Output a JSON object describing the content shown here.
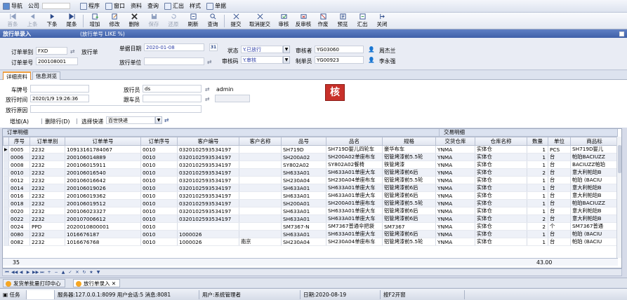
{
  "menubar": {
    "items": [
      "导航",
      "公司",
      "程序",
      "窗口",
      "资料",
      "查询",
      "汇出",
      "样式",
      "单据"
    ]
  },
  "toolbar": {
    "buttons": [
      "首条",
      "上条",
      "下条",
      "尾条",
      "增加",
      "修改",
      "删除",
      "保存",
      "还原",
      "刷新",
      "查询",
      "提交",
      "取消提交",
      "审核",
      "反审核",
      "作废",
      "预览",
      "汇出",
      "关闭"
    ]
  },
  "title": {
    "name": "放行单录入",
    "subtitle": "(放行单号 LIKE %)"
  },
  "header": {
    "order_type_label": "订单单别",
    "order_type_value": "FXD",
    "order_type_name": "放行单",
    "order_no_label": "订单单号",
    "order_no_value": "200108001",
    "date_label": "单据日期",
    "date_value": "2020-01-08",
    "date_btn": "31",
    "unit_label": "放行单位",
    "status_label": "状态",
    "status_value": "Y.已放行",
    "audit_code_label": "审核码",
    "audit_code_value": "Y.审核",
    "auditor_label": "审核者",
    "auditor_code": "YG03060",
    "auditor_name": "周杰兰",
    "maker_label": "制单员",
    "maker_code": "YG00923",
    "maker_name": "李永强"
  },
  "tabs": [
    "详细资料",
    "信息浏览"
  ],
  "detail": {
    "plate_label": "车牌号",
    "releaser_label": "放行员",
    "releaser_value": "ds",
    "releaser_name": "admin",
    "time_label": "放行时间",
    "time_value": "2020/1/9 19:26:36",
    "follower_label": "跟车员",
    "reason_label": "放行原因",
    "add_row": "增加(A)",
    "del_row": "删除行(D)",
    "express_label": "选择快递",
    "express_value": "百世快递",
    "audit_badge": "核"
  },
  "grid": {
    "group1": "订单明细",
    "group2": "交易明细",
    "columns": [
      "序号",
      "订单单别",
      "订单单号",
      "订单序号",
      "客户编号",
      "客户名称",
      "品号",
      "品名",
      "规格",
      "交货仓库",
      "仓库名称",
      "数量",
      "单位",
      "商品标"
    ],
    "rows": [
      [
        "0005",
        "2232",
        "10913161784067",
        "0010",
        "0320102593534197",
        "",
        "SH719D",
        "SH719D婴儿四轮车",
        "豪华布车",
        "YNMA",
        "实体仓",
        "1",
        "PCS",
        "SH719D婴儿"
      ],
      [
        "0006",
        "2232",
        "200106014889",
        "0010",
        "0320102593534197",
        "",
        "SH200A02",
        "SH200A02单座布车",
        "铝管烤漆前5.5轮",
        "YNMA",
        "实体仓",
        "1",
        "台",
        "帕珀BACIUZZ"
      ],
      [
        "0008",
        "2232",
        "200106015911",
        "0010",
        "0320102593534197",
        "",
        "SY802A02",
        "SY802A02餐椅",
        "铁管烤漆",
        "YNMA",
        "实体仓",
        "1",
        "台",
        "BACIUZZ帕珀"
      ],
      [
        "0010",
        "2232",
        "200106016540",
        "0010",
        "0320102593534197",
        "",
        "SH633A01",
        "SH633A01单座大车",
        "铝管烤漆前6后",
        "YNMA",
        "实体仓",
        "2",
        "台",
        "意大利帕珀B"
      ],
      [
        "0012",
        "2232",
        "200106016642",
        "0010",
        "0320102593534197",
        "",
        "SH230A04",
        "SH230A04单座布车",
        "铝管烤漆前5.5轮",
        "YNMA",
        "实体仓",
        "1",
        "台",
        "帕珀 (BACIU"
      ],
      [
        "0014",
        "2232",
        "200106019026",
        "0010",
        "0320102593534197",
        "",
        "SH633A01",
        "SH633A01单座大车",
        "铝管烤漆前6后",
        "YNMA",
        "实体仓",
        "1",
        "台",
        "意大利帕珀B"
      ],
      [
        "0016",
        "2232",
        "200106019362",
        "0010",
        "0320102593534197",
        "",
        "SH633A01",
        "SH633A01单座大车",
        "铝管烤漆前6后",
        "YNMA",
        "实体仓",
        "1",
        "台",
        "意大利帕珀B"
      ],
      [
        "0018",
        "2232",
        "200106019512",
        "0010",
        "0320102593534197",
        "",
        "SH200A01",
        "SH200A01单座布车",
        "铝管烤漆前5.5轮",
        "YNMA",
        "实体仓",
        "1",
        "台",
        "帕珀BACIUZZ"
      ],
      [
        "0020",
        "2232",
        "200106023327",
        "0010",
        "0320102593534197",
        "",
        "SH633A01",
        "SH633A01单座大车",
        "铝管烤漆前6后",
        "YNMA",
        "实体仓",
        "1",
        "台",
        "意大利帕珀B"
      ],
      [
        "0022",
        "2232",
        "200107006612",
        "0010",
        "0320102593534197",
        "",
        "SH633A01",
        "SH633A01单座大车",
        "铝管烤漆前6后",
        "YNMA",
        "实体仓",
        "2",
        "台",
        "意大利帕珀B"
      ],
      [
        "0024",
        "PPD",
        "2020010800001",
        "0010",
        "",
        "",
        "SM7367-N",
        "SM7367普通伞把袋",
        "SM7367",
        "YNMA",
        "实体仓",
        "2",
        "个",
        "SM7367普通"
      ],
      [
        "0080",
        "2232",
        "1016676187",
        "0010",
        "1000026",
        "",
        "SH633A01",
        "SH633A01单座大车",
        "铝管烤漆前6后",
        "YNMA",
        "实体仓",
        "1",
        "台",
        "帕珀 (BACIU"
      ],
      [
        "0082",
        "2232",
        "1016676768",
        "0010",
        "1000026",
        "南京",
        "SH230A04",
        "SH230A04单座布车",
        "铝管烤漆前5.5轮",
        "YNMA",
        "实体仓",
        "1",
        "台",
        "帕珀 (BACIU"
      ]
    ],
    "footer_count": "35",
    "footer_qty": "43.00"
  },
  "bottomtabs": [
    "发货单批量打印中心",
    "放行单录入"
  ],
  "status": {
    "task": "任务",
    "server": "服务器:127.0.0.1:8099 用户会话:5 消息:8081",
    "user": "用户:系统管理者",
    "date": "日期:2020-08-19",
    "hint": "按F2开窗"
  }
}
